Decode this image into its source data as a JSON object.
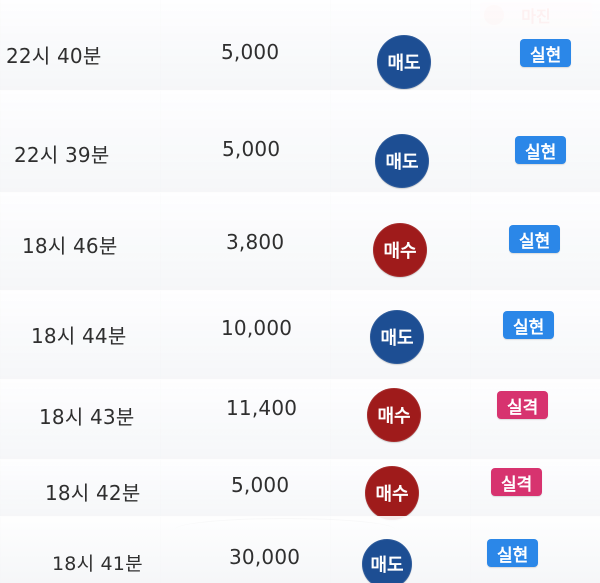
{
  "watermark": {
    "text": "마진"
  },
  "rows": [
    {
      "time": "22시 40분",
      "amount": "5,000",
      "type": "매도",
      "status": "실현"
    },
    {
      "time": "22시 39분",
      "amount": "5,000",
      "type": "매도",
      "status": "실현"
    },
    {
      "time": "18시 46분",
      "amount": "3,800",
      "type": "매수",
      "status": "실현"
    },
    {
      "time": "18시 44분",
      "amount": "10,000",
      "type": "매도",
      "status": "실현"
    },
    {
      "time": "18시 43분",
      "amount": "11,400",
      "type": "매수",
      "status": "실격"
    },
    {
      "time": "18시 42분",
      "amount": "5,000",
      "type": "매수",
      "status": "실격"
    },
    {
      "time": "18시 41분",
      "amount": "30,000",
      "type": "매도",
      "status": "실현"
    }
  ],
  "colors": {
    "sell": "#1d4e93",
    "buy": "#9f1b1b",
    "realized": "#2b87e8",
    "failed": "#d7336f",
    "text": "#2f2f2f"
  },
  "icons": {
    "logo": "margin-logo-icon"
  }
}
